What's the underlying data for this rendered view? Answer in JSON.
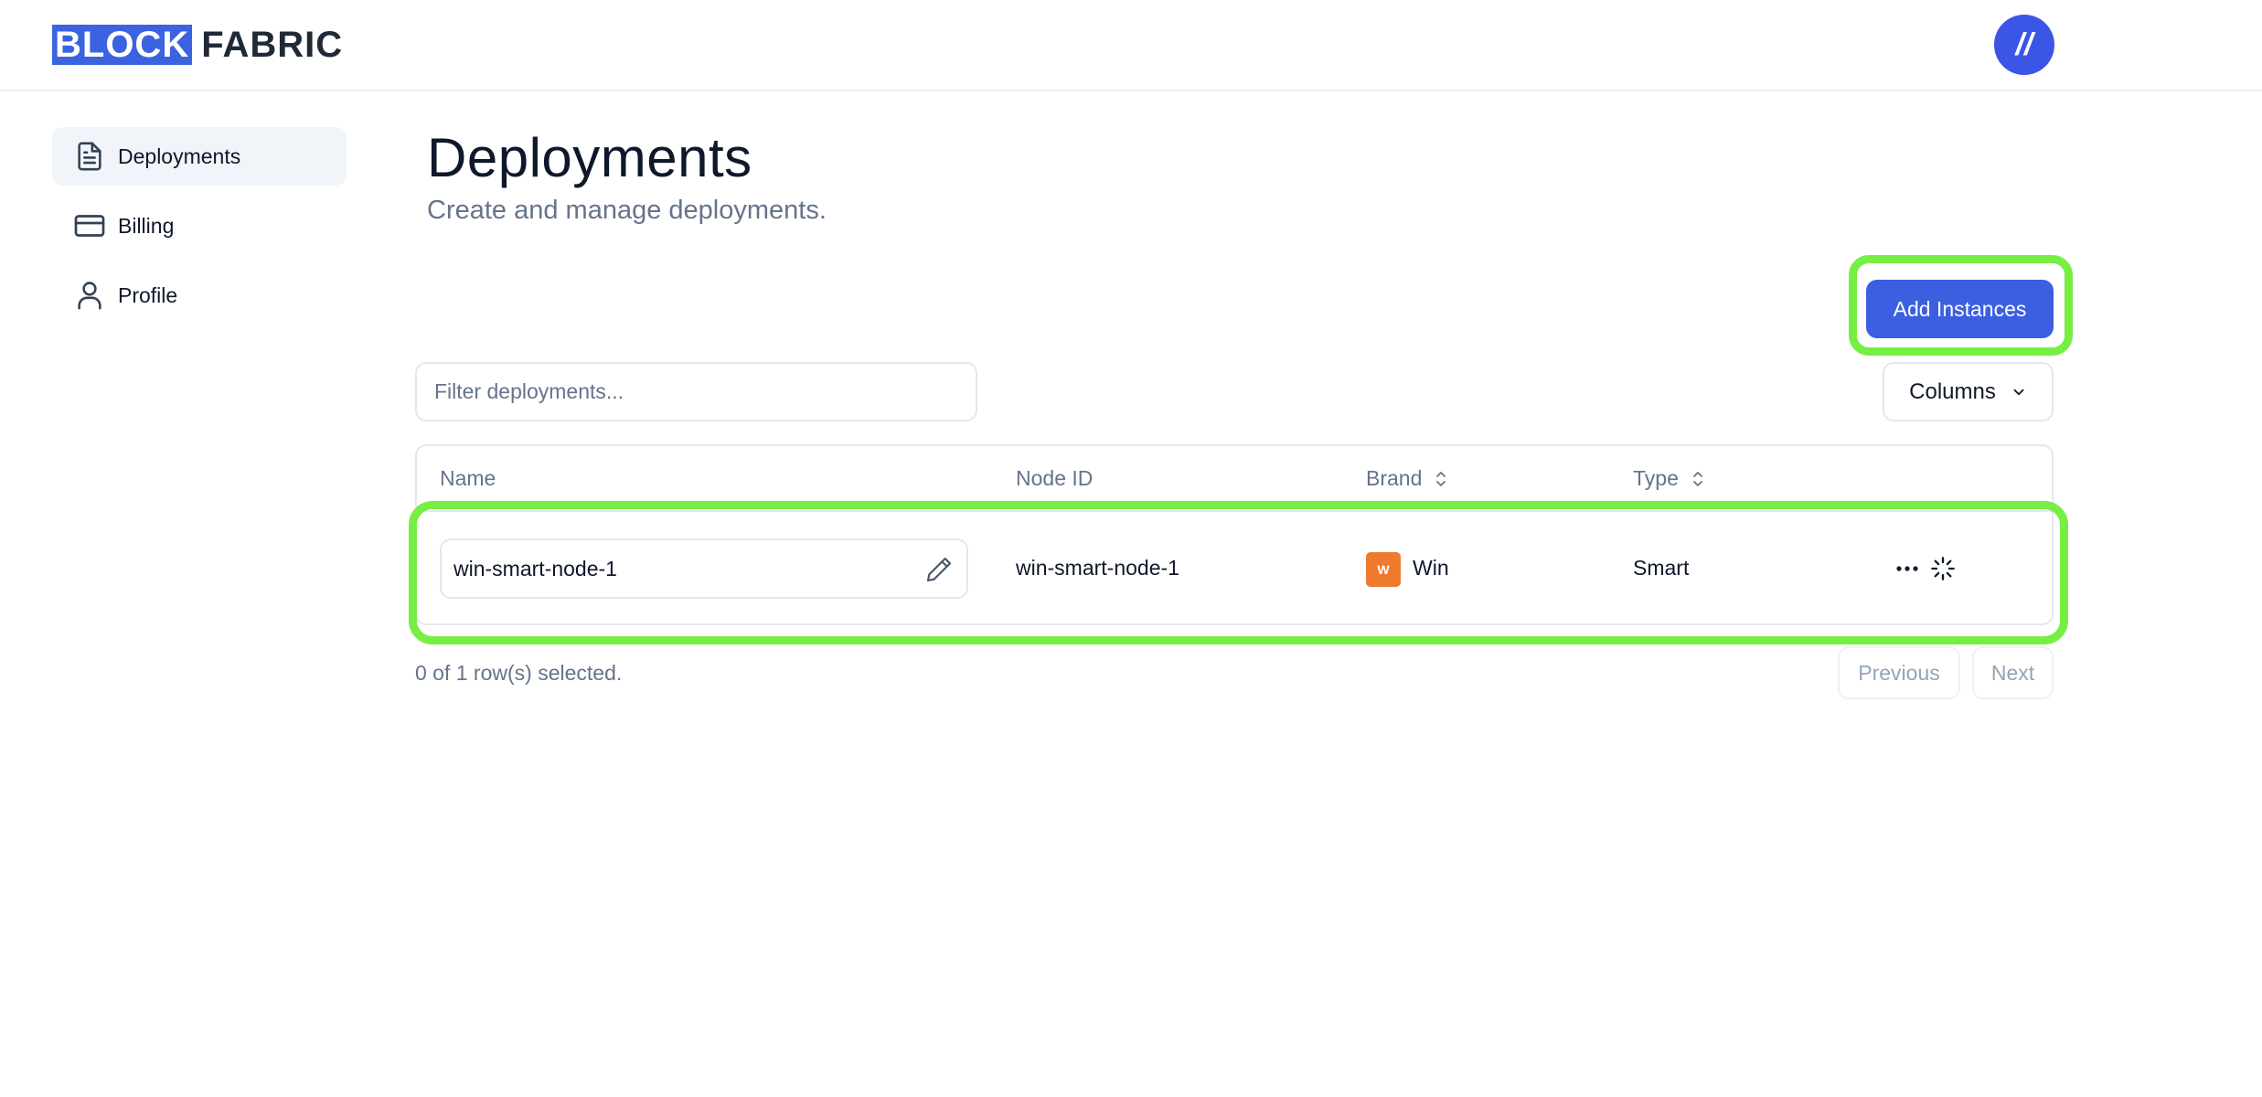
{
  "app": {
    "logo_block": "BLOCK",
    "logo_fabric": "FABRIC",
    "avatar_text": "//",
    "accent_color": "#3b5fe0"
  },
  "sidebar": {
    "items": [
      {
        "label": "Deployments",
        "icon": "document-icon",
        "active": true
      },
      {
        "label": "Billing",
        "icon": "credit-card-icon",
        "active": false
      },
      {
        "label": "Profile",
        "icon": "user-icon",
        "active": false
      }
    ]
  },
  "main": {
    "title": "Deployments",
    "subtitle": "Create and manage deployments.",
    "add_button_label": "Add Instances",
    "filter_placeholder": "Filter deployments...",
    "columns_button_label": "Columns"
  },
  "table": {
    "headers": [
      "Name",
      "Node ID",
      "Brand",
      "Type"
    ],
    "rows": [
      {
        "name": "win-smart-node-1",
        "node_id": "win-smart-node-1",
        "brand": "Win",
        "brand_logo_text": "W",
        "brand_color": "#ee7a2e",
        "type": "Smart"
      }
    ]
  },
  "footer": {
    "selected_text": "0 of 1 row(s) selected.",
    "previous_label": "Previous",
    "next_label": "Next"
  },
  "highlight_color": "#77ee44"
}
